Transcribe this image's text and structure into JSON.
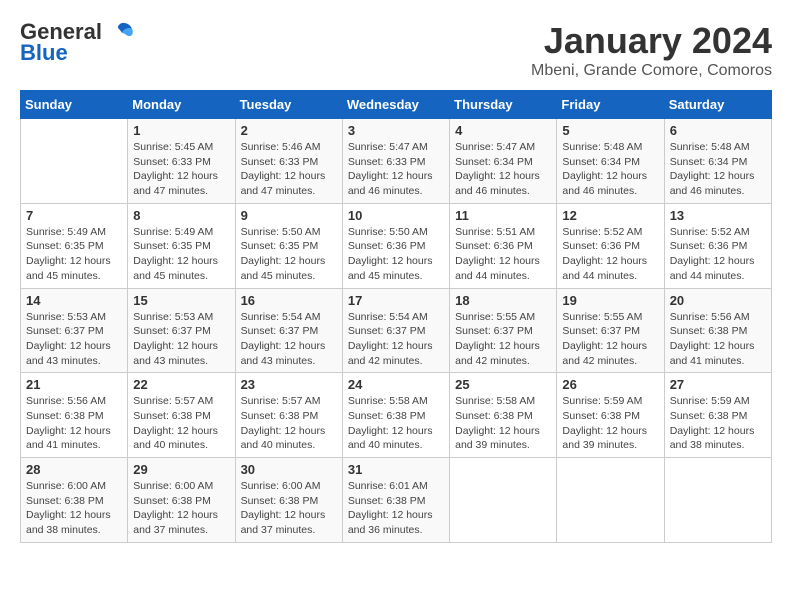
{
  "header": {
    "logo_line1": "General",
    "logo_line2": "Blue",
    "main_title": "January 2024",
    "subtitle": "Mbeni, Grande Comore, Comoros"
  },
  "calendar": {
    "days_of_week": [
      "Sunday",
      "Monday",
      "Tuesday",
      "Wednesday",
      "Thursday",
      "Friday",
      "Saturday"
    ],
    "weeks": [
      [
        {
          "day": "",
          "info": ""
        },
        {
          "day": "1",
          "info": "Sunrise: 5:45 AM\nSunset: 6:33 PM\nDaylight: 12 hours\nand 47 minutes."
        },
        {
          "day": "2",
          "info": "Sunrise: 5:46 AM\nSunset: 6:33 PM\nDaylight: 12 hours\nand 47 minutes."
        },
        {
          "day": "3",
          "info": "Sunrise: 5:47 AM\nSunset: 6:33 PM\nDaylight: 12 hours\nand 46 minutes."
        },
        {
          "day": "4",
          "info": "Sunrise: 5:47 AM\nSunset: 6:34 PM\nDaylight: 12 hours\nand 46 minutes."
        },
        {
          "day": "5",
          "info": "Sunrise: 5:48 AM\nSunset: 6:34 PM\nDaylight: 12 hours\nand 46 minutes."
        },
        {
          "day": "6",
          "info": "Sunrise: 5:48 AM\nSunset: 6:34 PM\nDaylight: 12 hours\nand 46 minutes."
        }
      ],
      [
        {
          "day": "7",
          "info": "Sunrise: 5:49 AM\nSunset: 6:35 PM\nDaylight: 12 hours\nand 45 minutes."
        },
        {
          "day": "8",
          "info": "Sunrise: 5:49 AM\nSunset: 6:35 PM\nDaylight: 12 hours\nand 45 minutes."
        },
        {
          "day": "9",
          "info": "Sunrise: 5:50 AM\nSunset: 6:35 PM\nDaylight: 12 hours\nand 45 minutes."
        },
        {
          "day": "10",
          "info": "Sunrise: 5:50 AM\nSunset: 6:36 PM\nDaylight: 12 hours\nand 45 minutes."
        },
        {
          "day": "11",
          "info": "Sunrise: 5:51 AM\nSunset: 6:36 PM\nDaylight: 12 hours\nand 44 minutes."
        },
        {
          "day": "12",
          "info": "Sunrise: 5:52 AM\nSunset: 6:36 PM\nDaylight: 12 hours\nand 44 minutes."
        },
        {
          "day": "13",
          "info": "Sunrise: 5:52 AM\nSunset: 6:36 PM\nDaylight: 12 hours\nand 44 minutes."
        }
      ],
      [
        {
          "day": "14",
          "info": "Sunrise: 5:53 AM\nSunset: 6:37 PM\nDaylight: 12 hours\nand 43 minutes."
        },
        {
          "day": "15",
          "info": "Sunrise: 5:53 AM\nSunset: 6:37 PM\nDaylight: 12 hours\nand 43 minutes."
        },
        {
          "day": "16",
          "info": "Sunrise: 5:54 AM\nSunset: 6:37 PM\nDaylight: 12 hours\nand 43 minutes."
        },
        {
          "day": "17",
          "info": "Sunrise: 5:54 AM\nSunset: 6:37 PM\nDaylight: 12 hours\nand 42 minutes."
        },
        {
          "day": "18",
          "info": "Sunrise: 5:55 AM\nSunset: 6:37 PM\nDaylight: 12 hours\nand 42 minutes."
        },
        {
          "day": "19",
          "info": "Sunrise: 5:55 AM\nSunset: 6:37 PM\nDaylight: 12 hours\nand 42 minutes."
        },
        {
          "day": "20",
          "info": "Sunrise: 5:56 AM\nSunset: 6:38 PM\nDaylight: 12 hours\nand 41 minutes."
        }
      ],
      [
        {
          "day": "21",
          "info": "Sunrise: 5:56 AM\nSunset: 6:38 PM\nDaylight: 12 hours\nand 41 minutes."
        },
        {
          "day": "22",
          "info": "Sunrise: 5:57 AM\nSunset: 6:38 PM\nDaylight: 12 hours\nand 40 minutes."
        },
        {
          "day": "23",
          "info": "Sunrise: 5:57 AM\nSunset: 6:38 PM\nDaylight: 12 hours\nand 40 minutes."
        },
        {
          "day": "24",
          "info": "Sunrise: 5:58 AM\nSunset: 6:38 PM\nDaylight: 12 hours\nand 40 minutes."
        },
        {
          "day": "25",
          "info": "Sunrise: 5:58 AM\nSunset: 6:38 PM\nDaylight: 12 hours\nand 39 minutes."
        },
        {
          "day": "26",
          "info": "Sunrise: 5:59 AM\nSunset: 6:38 PM\nDaylight: 12 hours\nand 39 minutes."
        },
        {
          "day": "27",
          "info": "Sunrise: 5:59 AM\nSunset: 6:38 PM\nDaylight: 12 hours\nand 38 minutes."
        }
      ],
      [
        {
          "day": "28",
          "info": "Sunrise: 6:00 AM\nSunset: 6:38 PM\nDaylight: 12 hours\nand 38 minutes."
        },
        {
          "day": "29",
          "info": "Sunrise: 6:00 AM\nSunset: 6:38 PM\nDaylight: 12 hours\nand 37 minutes."
        },
        {
          "day": "30",
          "info": "Sunrise: 6:00 AM\nSunset: 6:38 PM\nDaylight: 12 hours\nand 37 minutes."
        },
        {
          "day": "31",
          "info": "Sunrise: 6:01 AM\nSunset: 6:38 PM\nDaylight: 12 hours\nand 36 minutes."
        },
        {
          "day": "",
          "info": ""
        },
        {
          "day": "",
          "info": ""
        },
        {
          "day": "",
          "info": ""
        }
      ]
    ]
  }
}
